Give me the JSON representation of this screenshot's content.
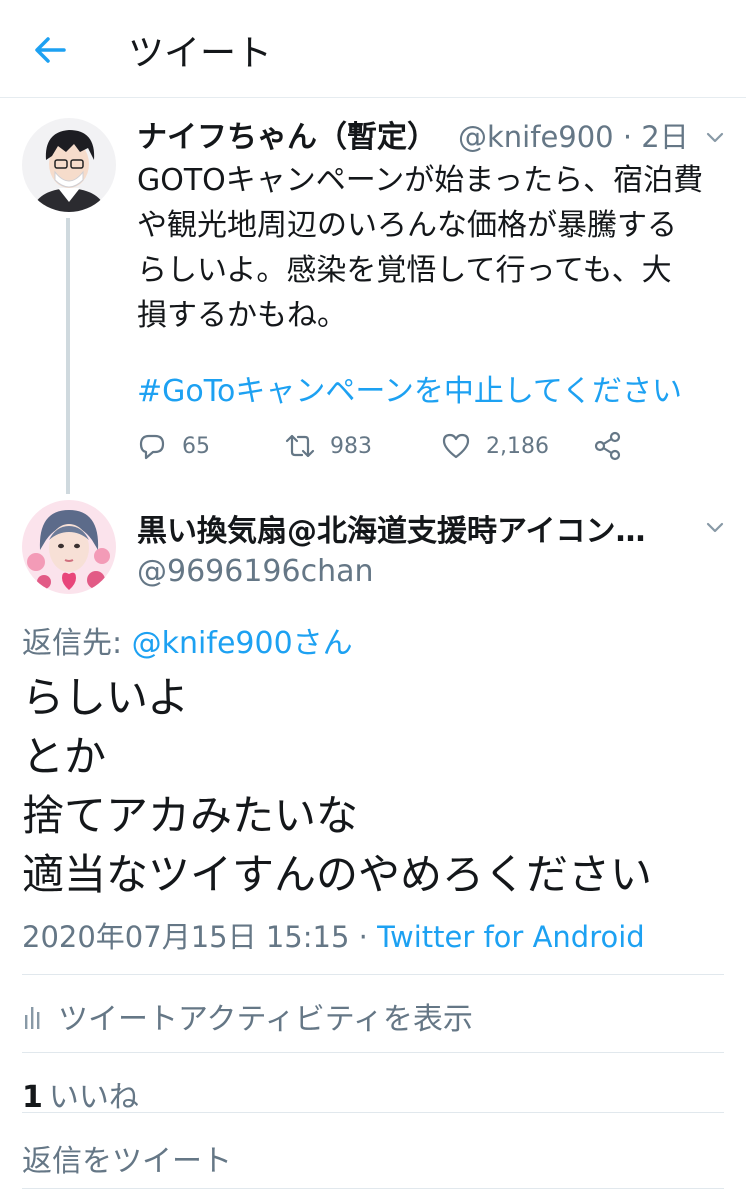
{
  "header": {
    "title": "ツイート",
    "back_icon": "arrow-left-icon",
    "accent_color": "#1da1f2"
  },
  "parent_tweet": {
    "name": "ナイフちゃん（暫定）",
    "handle_time": "@knife900 · 2日",
    "text_lines": [
      "GOTOキャンペーンが始まったら、宿泊費",
      "や観光地周辺のいろんな価格が暴騰する",
      "らしいよ。感染を覚悟して行っても、大",
      "損するかもね。"
    ],
    "hashtag": "#GoToキャンペーンを中止してください",
    "actions": {
      "reply_count": "65",
      "retweet_count": "983",
      "like_count": "2,186"
    }
  },
  "reply_tweet": {
    "name": "黒い換気扇@北海道支援時アイコン…",
    "handle": "@9696196chan",
    "reply_to_label": "返信先: ",
    "reply_to_mention": "@knife900さん",
    "text_lines": [
      "らしいよ",
      "とか",
      "捨てアカみたいな",
      "適当なツイすんのやめろください"
    ],
    "timestamp": "2020年07月15日 15:15 · ",
    "source": "Twitter for Android"
  },
  "activity_label": "ツイートアクティビティを表示",
  "likes": {
    "count": "1",
    "label": "いいね"
  },
  "reply_placeholder": "返信をツイート"
}
